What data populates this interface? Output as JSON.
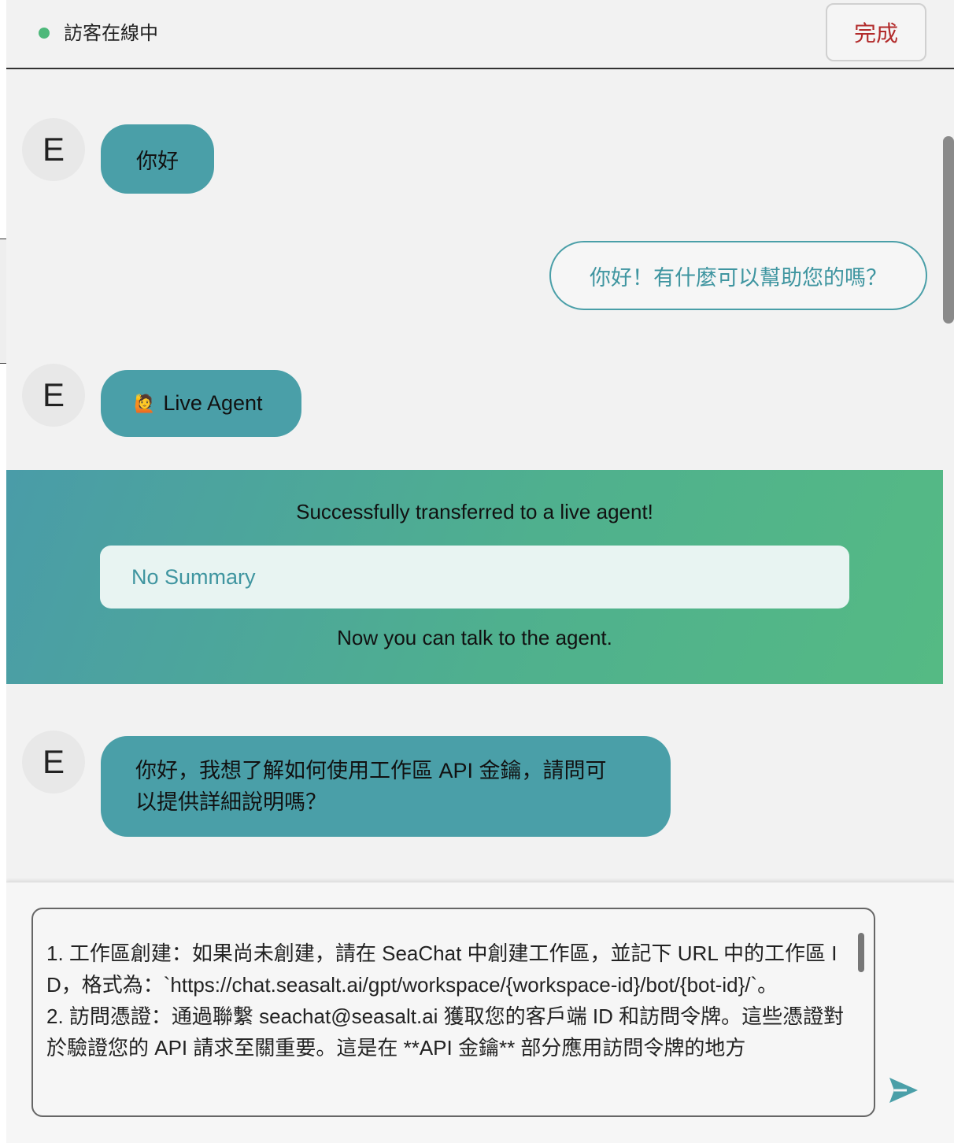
{
  "header": {
    "status_text": "訪客在線中",
    "done_label": "完成"
  },
  "messages": {
    "m1": {
      "avatar": "E",
      "text": "你好"
    },
    "m2": {
      "text": "你好！有什麼可以幫助您的嗎？"
    },
    "m3": {
      "avatar": "E",
      "emoji": "🙋",
      "text": "Live Agent"
    },
    "m4": {
      "avatar": "E",
      "line1": "你好，我想了解如何使用工作區 API 金鑰，請問可",
      "line2": "以提供詳細說明嗎？"
    }
  },
  "transfer": {
    "title": "Successfully transferred to a live agent!",
    "summary": "No Summary",
    "footer": "Now you can talk to the agent."
  },
  "composer": {
    "draft": "1. 工作區創建：如果尚未創建，請在 SeaChat 中創建工作區，並記下 URL 中的工作區 ID，格式為：`https://chat.seasalt.ai/gpt/workspace/{workspace-id}/bot/{bot-id}/`。\n2. 訪問憑證：通過聯繫 seachat@seasalt.ai 獲取您的客戶端 ID 和訪問令牌。這些憑證對於驗證您的 API 請求至關重要。這是在 **API 金鑰** 部分應用訪問令牌的地方"
  },
  "colors": {
    "accent": "#4a9fa8",
    "online": "#4db87a",
    "done": "#b22a2a",
    "gradient_end": "#55ba84"
  },
  "icons": {
    "status": "online-dot-icon",
    "send": "send-icon"
  }
}
